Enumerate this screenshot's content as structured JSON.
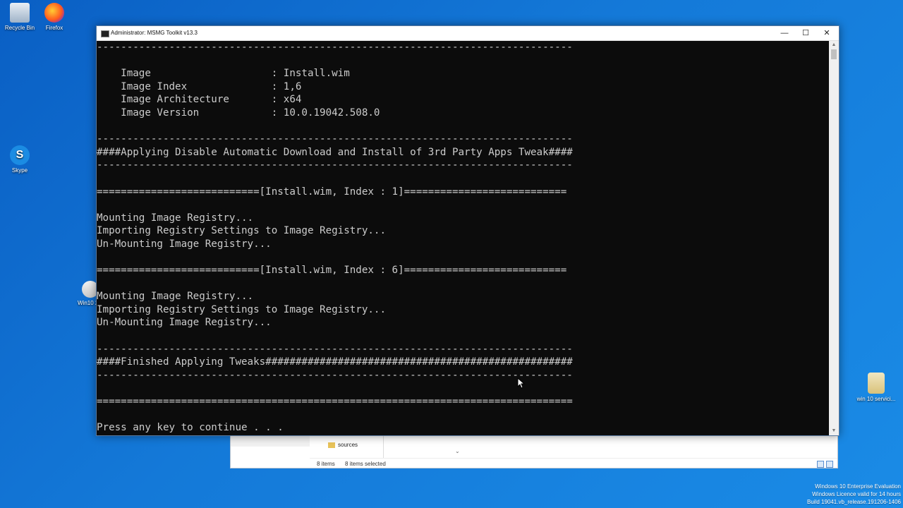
{
  "desktop": {
    "icons": [
      {
        "label": "Recycle Bin"
      },
      {
        "label": "Firefox"
      },
      {
        "label": "Skype"
      },
      {
        "label": "Win10 2..."
      },
      {
        "label": "win 10 servici..."
      }
    ]
  },
  "explorer": {
    "folder_label": "sources",
    "item_count": "8 items",
    "selected_count": "8 items selected"
  },
  "console": {
    "title": "Administrator:  MSMG Toolkit v13.3",
    "controls": {
      "minimize": "—",
      "maximize": "☐",
      "close": "✕"
    },
    "lines": [
      "-------------------------------------------------------------------------------",
      "",
      "    Image                    : Install.wim",
      "    Image Index              : 1,6",
      "    Image Architecture       : x64",
      "    Image Version            : 10.0.19042.508.0",
      "",
      "-------------------------------------------------------------------------------",
      "####Applying Disable Automatic Download and Install of 3rd Party Apps Tweak####",
      "-------------------------------------------------------------------------------",
      "",
      "===========================[Install.wim, Index : 1]===========================",
      "",
      "Mounting Image Registry...",
      "Importing Registry Settings to Image Registry...",
      "Un-Mounting Image Registry...",
      "",
      "===========================[Install.wim, Index : 6]===========================",
      "",
      "Mounting Image Registry...",
      "Importing Registry Settings to Image Registry...",
      "Un-Mounting Image Registry...",
      "",
      "-------------------------------------------------------------------------------",
      "####Finished Applying Tweaks###################################################",
      "-------------------------------------------------------------------------------",
      "",
      "===============================================================================",
      "",
      "Press any key to continue . . ."
    ]
  },
  "watermark": {
    "line1": "Windows 10 Enterprise Evaluation",
    "line2": "Windows Licence valid for 14 hours",
    "line3": "Build 19041.vb_release.191206-1406"
  }
}
